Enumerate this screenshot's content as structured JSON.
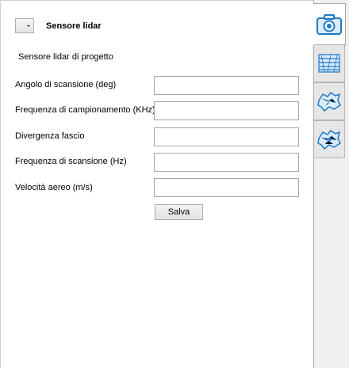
{
  "header": {
    "title": "Sensore lidar"
  },
  "section": {
    "subtitle": "Sensore lidar di progetto"
  },
  "fields": [
    {
      "label": "Angolo di scansione (deg)",
      "value": ""
    },
    {
      "label": "Frequenza di campionamento (KHz)",
      "value": ""
    },
    {
      "label": "Divergenza fascio",
      "value": ""
    },
    {
      "label": "Frequenza di scansione (Hz)",
      "value": ""
    },
    {
      "label": "Velocità aereo (m/s)",
      "value": ""
    }
  ],
  "actions": {
    "save_label": "Salva"
  },
  "tabs": [
    {
      "icon": "camera-icon",
      "active": true
    },
    {
      "icon": "flight-lines-icon",
      "active": false
    },
    {
      "icon": "map-area-icon",
      "active": false
    },
    {
      "icon": "map-area-settings-icon",
      "active": false
    }
  ],
  "colors": {
    "icon_blue": "#1e7ac8",
    "icon_bg": "#dcebf8"
  }
}
